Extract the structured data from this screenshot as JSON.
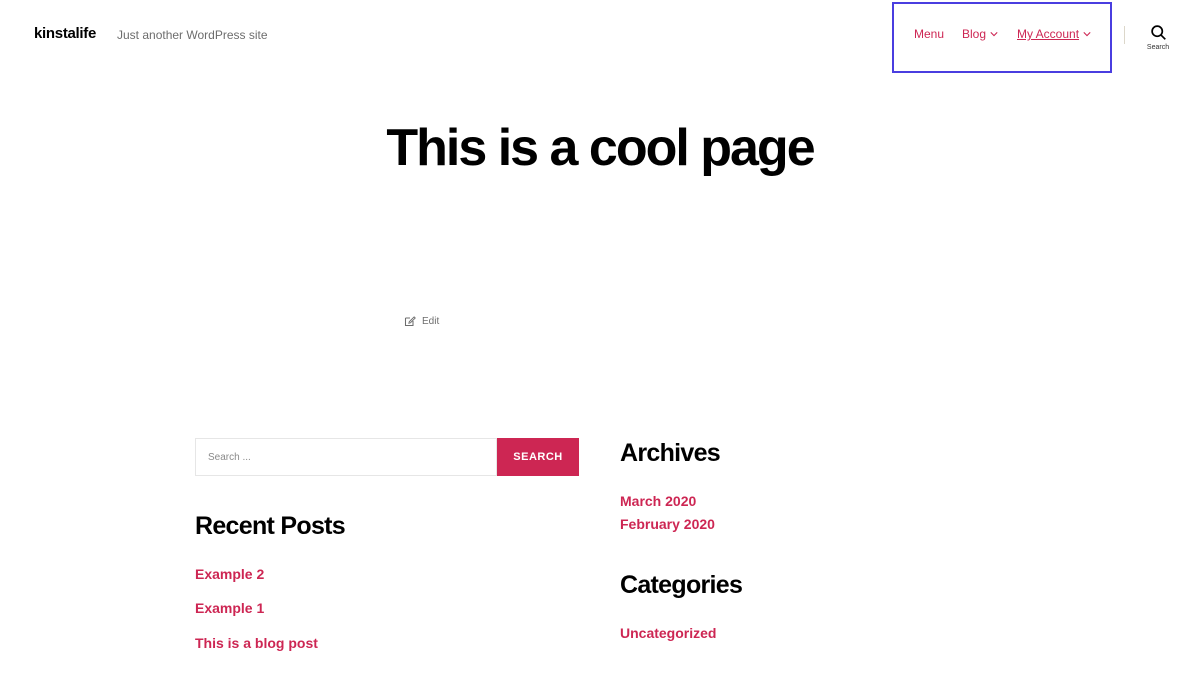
{
  "header": {
    "site_title": "kinstalife",
    "site_description": "Just another WordPress site",
    "nav": [
      {
        "label": "Menu"
      },
      {
        "label": "Blog"
      },
      {
        "label": "My Account"
      }
    ],
    "search_toggle_label": "Search"
  },
  "main": {
    "title": "This is a cool page",
    "edit_label": "Edit"
  },
  "widgets": {
    "search": {
      "placeholder": "Search ...",
      "button_label": "SEARCH"
    },
    "recent_posts": {
      "title": "Recent Posts",
      "items": [
        "Example 2",
        "Example 1",
        "This is a blog post"
      ]
    },
    "archives": {
      "title": "Archives",
      "items": [
        "March 2020",
        "February 2020"
      ]
    },
    "categories": {
      "title": "Categories",
      "items": [
        "Uncategorized"
      ]
    }
  },
  "colors": {
    "accent": "#cd2653",
    "highlight_box": "#4a3ee0",
    "text": "#000000",
    "muted": "#6d6d6d"
  }
}
